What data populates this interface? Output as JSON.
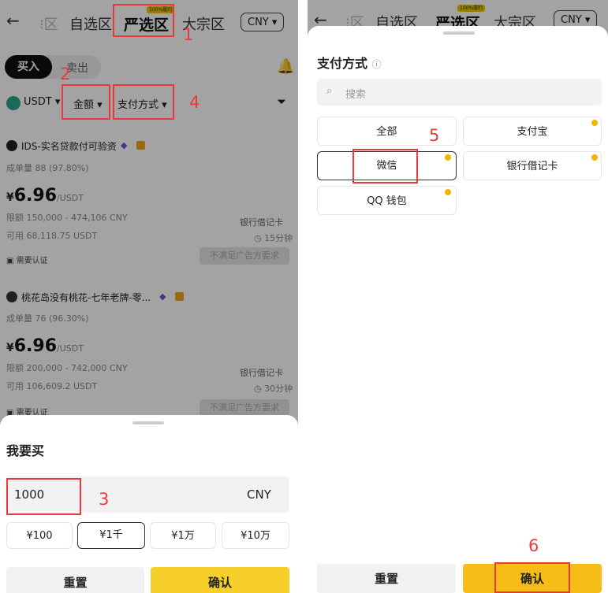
{
  "left_screen": {
    "topbar": {
      "back_icon": "←",
      "tab_partial": "区",
      "tab_watchlist": "自选区",
      "tab_selected": "严选区",
      "tab_selected_badge": "100%履约",
      "tab_bulk": "大宗区",
      "currency": "CNY"
    },
    "trade_tabs": {
      "buy": "买入",
      "sell": "卖出"
    },
    "filters": {
      "asset": "USDT",
      "amount": "金额",
      "payment": "支付方式"
    },
    "offers": [
      {
        "merchant": "IDS-实名贷款付可验资",
        "stats": "成单量 88 (97.80%)",
        "price_symbol": "¥",
        "price": "6.96",
        "price_unit": "/USDT",
        "limit": "限额 150,000 - 474,106 CNY",
        "available": "可用 68,118.75 USDT",
        "method": "银行借记卡",
        "time": "15分钟",
        "verify": "需要认证",
        "action": "不满足广告方要求"
      },
      {
        "merchant": "桃花岛没有桃花-七年老牌-零...",
        "stats": "成单量 76 (96.30%)",
        "price_symbol": "¥",
        "price": "6.96",
        "price_unit": "/USDT",
        "limit": "限额 200,000 - 742,000 CNY",
        "available": "可用 106,609.2 USDT",
        "method": "银行借记卡",
        "time": "30分钟",
        "verify": "需要认证",
        "action": "不满足广告方要求"
      }
    ],
    "buy_sheet": {
      "title": "我要买",
      "amount_value": "1000",
      "amount_currency": "CNY",
      "presets": [
        "¥100",
        "¥1千",
        "¥1万",
        "¥10万"
      ],
      "selected_preset": 1,
      "reset_label": "重置",
      "confirm_label": "确认"
    },
    "annotations": [
      "1",
      "2",
      "3",
      "4"
    ]
  },
  "right_screen": {
    "topbar": {
      "back_icon": "←",
      "tab_partial": "区",
      "tab_watchlist": "自选区",
      "tab_selected": "严选区",
      "tab_selected_badge": "100%履约",
      "tab_bulk": "大宗区",
      "currency": "CNY"
    },
    "payment_sheet": {
      "title": "支付方式",
      "info_icon": "ⓘ",
      "search_placeholder": "搜索",
      "options": [
        "全部",
        "支付宝",
        "微信",
        "银行借记卡",
        "QQ 钱包"
      ],
      "selected_option": "微信",
      "reset_label": "重置",
      "confirm_label": "确认"
    },
    "annotations": [
      "5",
      "6"
    ]
  },
  "colors": {
    "accent_yellow": "#f7cf2b",
    "annotation_red": "#e8393b",
    "button_gray": "#f1f1f1"
  }
}
